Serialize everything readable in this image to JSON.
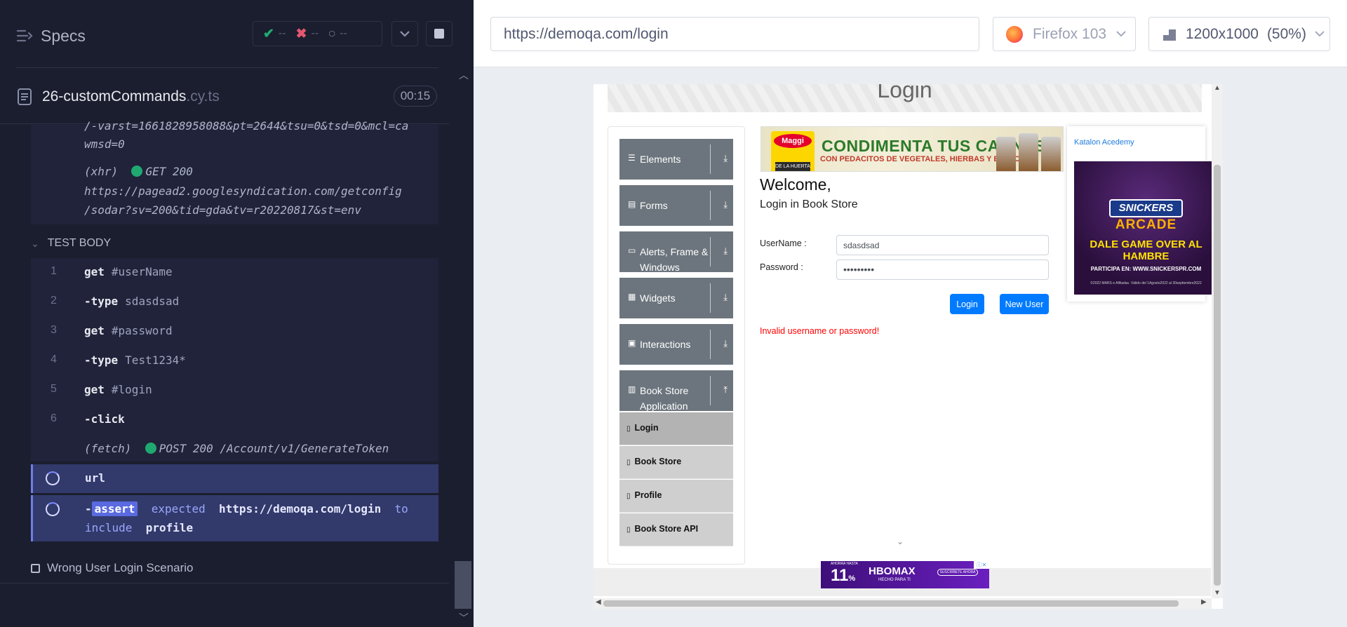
{
  "reporter": {
    "specs_label": "Specs",
    "stats": {
      "passed": "--",
      "failed": "--",
      "pending": "--"
    },
    "spec_file": {
      "name": "26-customCommands",
      "ext": ".cy.ts",
      "time": "00:15"
    },
    "prev_log": {
      "line1": "/-varst=1661828958088&pt=2644&tsu=0&tsd=0&mcl=ca",
      "line2": "wmsd=0",
      "xhr_label": "(xhr)",
      "xhr_status": "GET 200",
      "xhr_url1": "https://pagead2.googlesyndication.com/getconfig",
      "xhr_url2": "/sodar?sv=200&tid=gda&tv=r20220817&st=env"
    },
    "test_body_label": "TEST BODY",
    "commands": [
      {
        "num": "1",
        "name": "get",
        "arg": "#userName"
      },
      {
        "num": "2",
        "name": "-type",
        "arg": "sdasdsad"
      },
      {
        "num": "3",
        "name": "get",
        "arg": "#password"
      },
      {
        "num": "4",
        "name": "-type",
        "arg": "Test1234*"
      },
      {
        "num": "5",
        "name": "get",
        "arg": "#login"
      },
      {
        "num": "6",
        "name": "-click",
        "arg": ""
      }
    ],
    "fetch": {
      "label": "(fetch)",
      "status": "POST 200 /Account/v1/GenerateToken"
    },
    "pending_url": "url",
    "assertion": {
      "prefix": "-",
      "keyword": "assert",
      "expected": "expected",
      "value": "https://demoqa.com/login",
      "to": "to",
      "include": "include",
      "target": "profile"
    },
    "next_test": "Wrong User Login Scenario"
  },
  "aut": {
    "url": "https://demoqa.com/login",
    "browser": "Firefox 103",
    "viewport": "1200x1000",
    "scale": "(50%)"
  },
  "page": {
    "banner_title": "Login",
    "sidebar_groups": [
      {
        "label": "Elements",
        "icon": "☰"
      },
      {
        "label": "Forms",
        "icon": "▤"
      },
      {
        "label": "Alerts, Frame & Windows",
        "icon": "▭"
      },
      {
        "label": "Widgets",
        "icon": "▦"
      },
      {
        "label": "Interactions",
        "icon": "▣"
      },
      {
        "label": "Book Store Application",
        "icon": "▥"
      }
    ],
    "sidebar_items": [
      "Login",
      "Book Store",
      "Profile",
      "Book Store API"
    ],
    "ad_top": {
      "brand": "Maggi",
      "sub": "DE LA HUERTA",
      "headline": "CONDIMENTA TUS CARNES",
      "subline": "CON PEDACITOS DE VEGETALES, HIERBAS Y ESPECIAS"
    },
    "welcome": "Welcome,",
    "welcome_sub": "Login in Book Store",
    "username_label": "UserName :",
    "username_value": "sdasdsad",
    "password_label": "Password :",
    "password_value": "•••••••••",
    "login_btn": "Login",
    "new_user_btn": "New User",
    "error": "Invalid username or password!",
    "katalon": "Katalon Acedemy",
    "snickers": {
      "brand": "SNICKERS",
      "arcade": "ARCADE",
      "tagline": "DALE GAME OVER AL HAMBRE",
      "participa": "PARTICIPA EN: WWW.SNICKERSPR.COM",
      "fine": "©2022 MARS e Afiliadas. Válido del 1Agosto2022 al 30septiembre2022"
    },
    "hbo": {
      "top": "AHORRA HASTA",
      "pct": "11",
      "pct_sign": "%",
      "brand": "HBOMAX",
      "sub": "HECHO PARA TI",
      "cta": "SUSCRÍBETE AHORA"
    }
  }
}
